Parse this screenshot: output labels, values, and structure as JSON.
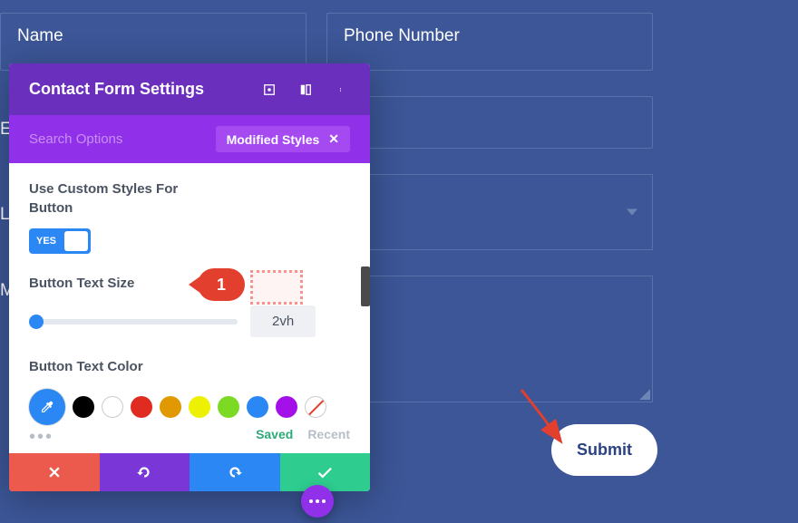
{
  "background_color": "#3c5697",
  "form_fields": {
    "name": "Name",
    "phone": "Phone Number",
    "email_partial": "E",
    "location_partial": "Lo",
    "message_partial": "M"
  },
  "submit_button": "Submit",
  "settings_panel": {
    "title": "Contact Form Settings",
    "search_placeholder": "Search Options",
    "modified_tag": "Modified Styles",
    "use_custom_label": "Use Custom Styles For Button",
    "toggle_yes": "YES",
    "text_size_label": "Button Text Size",
    "text_size_value": "2vh",
    "text_color_label": "Button Text Color",
    "saved_label": "Saved",
    "recent_label": "Recent"
  },
  "annotation_1": "1",
  "colors": {
    "panel_header": "#6b2fbd",
    "search_row": "#9030e8",
    "primary_blue": "#2b87f3",
    "cancel": "#ec5a4e",
    "undo": "#7a36d6",
    "save_green": "#2ecc8f",
    "annotation_red": "#e23f2f"
  },
  "color_swatches": [
    "black",
    "white",
    "red",
    "orange",
    "yellow",
    "green",
    "blue",
    "purple",
    "reset"
  ]
}
